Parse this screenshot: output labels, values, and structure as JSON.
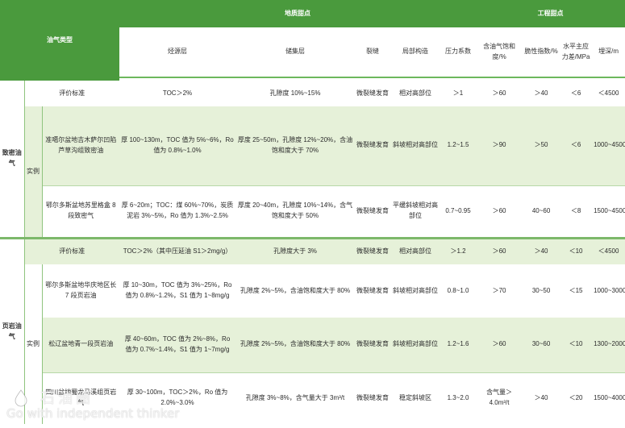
{
  "header": {
    "type_label": "油气类型",
    "geo_group": "地质甜点",
    "eng_group": "工程甜点",
    "cols": {
      "source": "烃源层",
      "reservoir": "储集层",
      "fracture": "裂缝",
      "structure": "局部构造",
      "pressure": "压力系数",
      "saturation": "含油气饱和度/%",
      "brittle": "脆性指数/%",
      "stress": "水平主应力差/MPa",
      "depth": "埋深/m"
    }
  },
  "sections": [
    {
      "name": "致密油气",
      "eval": {
        "label": "评价标准",
        "source": "TOC＞2%",
        "reservoir": "孔隙度 10%~15%",
        "fracture": "微裂缝发育",
        "structure": "相对高部位",
        "pressure": "＞1",
        "saturation": "＞60",
        "brittle": "＞40",
        "stress": "＜6",
        "depth": "＜4500"
      },
      "example_label": "实例",
      "examples": [
        {
          "name": "准噶尔盆地吉木萨尔凹陷芦草沟组致密油",
          "source": "厚 100~130m，TOC 值为 5%~6%，Ro 值为 0.8%~1.0%",
          "reservoir": "厚度 25~50m，孔隙度 12%~20%，含油饱和度大于 70%",
          "fracture": "微裂缝发育",
          "structure": "斜坡相对高部位",
          "pressure": "1.2~1.5",
          "saturation": "＞90",
          "brittle": "＞50",
          "stress": "＜6",
          "depth": "1000~4500"
        },
        {
          "name": "鄂尔多斯盆地苏里格盒 8 段致密气",
          "source": "厚 6~20m；TOC：煤 60%~70%，炭质泥岩 3%~5%，Ro 值为 1.3%~2.5%",
          "reservoir": "厚度 20~40m，孔隙度 10%~14%，含气饱和度大于 50%",
          "fracture": "微裂缝发育",
          "structure": "平缓斜坡相对高部位",
          "pressure": "0.7~0.95",
          "saturation": "＞60",
          "brittle": "40~60",
          "stress": "＜8",
          "depth": "1500~4500"
        }
      ]
    },
    {
      "name": "页岩油气",
      "eval": {
        "label": "评价标准",
        "source": "TOC＞2%（其中压延油 S1＞2mg/g）",
        "reservoir": "孔隙度大于 3%",
        "fracture": "微裂缝发育",
        "structure": "相对高部位",
        "pressure": "＞1.2",
        "saturation": "＞60",
        "brittle": "＞40",
        "stress": "＜10",
        "depth": "＜4500"
      },
      "example_label": "实例",
      "examples": [
        {
          "name": "鄂尔多斯盆地华庆地区长 7 段页岩油",
          "source": "厚 10~30m，TOC 值为 3%~25%，Ro 值为 0.8%~1.2%，S1 值为 1~8mg/g",
          "reservoir": "孔隙度 2%~5%，含油饱和度大于 80%",
          "fracture": "微裂缝发育",
          "structure": "斜坡相对高部位",
          "pressure": "0.8~1.0",
          "saturation": "＞70",
          "brittle": "30~50",
          "stress": "＜15",
          "depth": "1000~3000"
        },
        {
          "name": "松辽盆地青一段页岩油",
          "source": "厚 40~60m，TOC 值为 2%~8%，Ro 值为 0.7%~1.4%，S1 值为 1~7mg/g",
          "reservoir": "孔隙度 2%~5%，含油饱和度大于 80%",
          "fracture": "微裂缝发育",
          "structure": "斜坡相对高部位",
          "pressure": "1.2~1.6",
          "saturation": "＞60",
          "brittle": "30~60",
          "stress": "＜10",
          "depth": "1300~2000"
        },
        {
          "name": "四川盆地蜀龙马溪组页岩气",
          "source": "厚 30~100m，TOC＞2%，Ro 值为 2.0%~3.0%",
          "reservoir": "孔隙度 3%~8%，含气量大于 3m³/t",
          "fracture": "微裂缝发育",
          "structure": "稳定斜坡区",
          "pressure": "1.3~2.0",
          "saturation": "含气量＞4.0m³/t",
          "brittle": "＞40",
          "stress": "＜20",
          "depth": "1500~4000"
        }
      ]
    }
  ],
  "watermark": {
    "cn": "石油圈",
    "en": "Go with independent thinker"
  }
}
